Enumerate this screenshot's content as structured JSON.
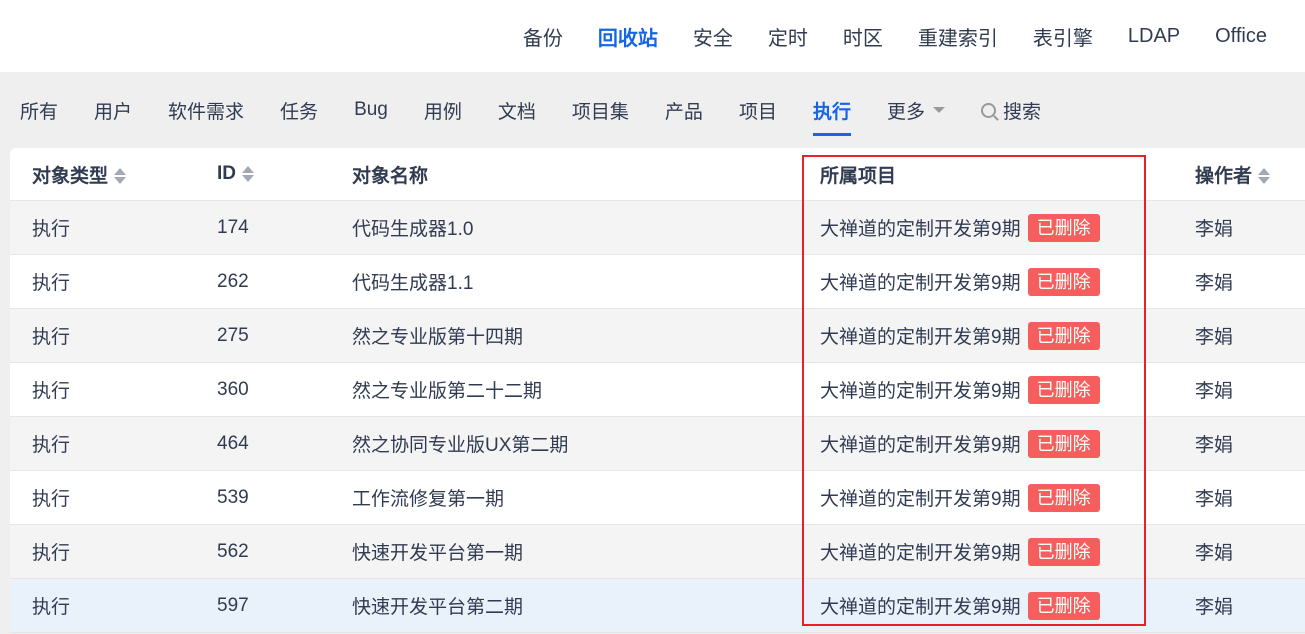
{
  "topnav": [
    "备份",
    "回收站",
    "安全",
    "定时",
    "时区",
    "重建索引",
    "表引擎",
    "LDAP",
    "Office"
  ],
  "topnav_active": 1,
  "subnav": [
    "所有",
    "用户",
    "软件需求",
    "任务",
    "Bug",
    "用例",
    "文档",
    "项目集",
    "产品",
    "项目",
    "执行"
  ],
  "subnav_active": 10,
  "more_label": "更多",
  "search_label": "搜索",
  "table": {
    "headers": {
      "type": "对象类型",
      "id": "ID",
      "name": "对象名称",
      "project": "所属项目",
      "actor": "操作者"
    },
    "rows": [
      {
        "type": "执行",
        "id": "174",
        "name": "代码生成器1.0",
        "project": "大禅道的定制开发第9期",
        "badge": "已删除",
        "actor": "李娟"
      },
      {
        "type": "执行",
        "id": "262",
        "name": "代码生成器1.1",
        "project": "大禅道的定制开发第9期",
        "badge": "已删除",
        "actor": "李娟"
      },
      {
        "type": "执行",
        "id": "275",
        "name": "然之专业版第十四期",
        "project": "大禅道的定制开发第9期",
        "badge": "已删除",
        "actor": "李娟"
      },
      {
        "type": "执行",
        "id": "360",
        "name": "然之专业版第二十二期",
        "project": "大禅道的定制开发第9期",
        "badge": "已删除",
        "actor": "李娟"
      },
      {
        "type": "执行",
        "id": "464",
        "name": "然之协同专业版UX第二期",
        "project": "大禅道的定制开发第9期",
        "badge": "已删除",
        "actor": "李娟"
      },
      {
        "type": "执行",
        "id": "539",
        "name": "工作流修复第一期",
        "project": "大禅道的定制开发第9期",
        "badge": "已删除",
        "actor": "李娟"
      },
      {
        "type": "执行",
        "id": "562",
        "name": "快速开发平台第一期",
        "project": "大禅道的定制开发第9期",
        "badge": "已删除",
        "actor": "李娟"
      },
      {
        "type": "执行",
        "id": "597",
        "name": "快速开发平台第二期",
        "project": "大禅道的定制开发第9期",
        "badge": "已删除",
        "actor": "李娟"
      }
    ]
  },
  "colors": {
    "accent": "#1565e6",
    "badge": "#f65e5e",
    "highlight": "#e8202a"
  }
}
